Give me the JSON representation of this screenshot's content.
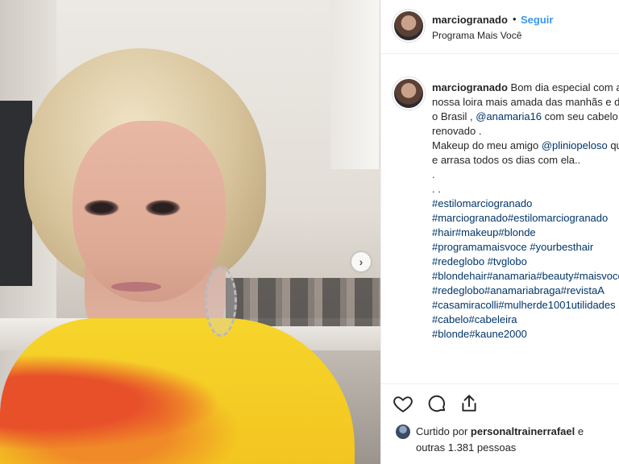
{
  "post": {
    "username": "marciogranado",
    "separator": "•",
    "follow_label": "Seguir",
    "location": "Programa Mais Você"
  },
  "caption": {
    "username": "marciogranado",
    "text_1": " Bom dia especial com a nossa loira mais amada das manhãs e do Brasil , ",
    "mention_1": "@anamaria16",
    "text_2": " com seu cabelo renovado .\nMakeup do meu amigo ",
    "mention_2": "@pliniopeloso",
    "text_3": " que arrasa todos os dias com ela..\n.\n. .\n",
    "hashtags": "#estilomarciogranado\n#marciogranado#estilomarciogranado\n#hair#makeup#blonde\n#programamaisvoce #yourbesthair\n#redeglobo #tvglobo\n#blondehair#anamaria#beauty#maisvoce#redeglobo#anamariabraga#revistaA\n#casamiracolli#mulherde1001utilidades #cabelo#cabeleira\n#blonde#kaune2000"
  },
  "likes": {
    "prefix": "Curtido por ",
    "user": "personaltrainerrafael",
    "connector": " e",
    "others": "outras 1.381 pessoas"
  },
  "icons": {
    "like": "heart-icon",
    "comment": "comment-icon",
    "share": "share-icon",
    "carousel": "chevron-right-icon"
  },
  "colors": {
    "link": "#3897f0",
    "hashtag": "#003569",
    "text": "#262626"
  }
}
